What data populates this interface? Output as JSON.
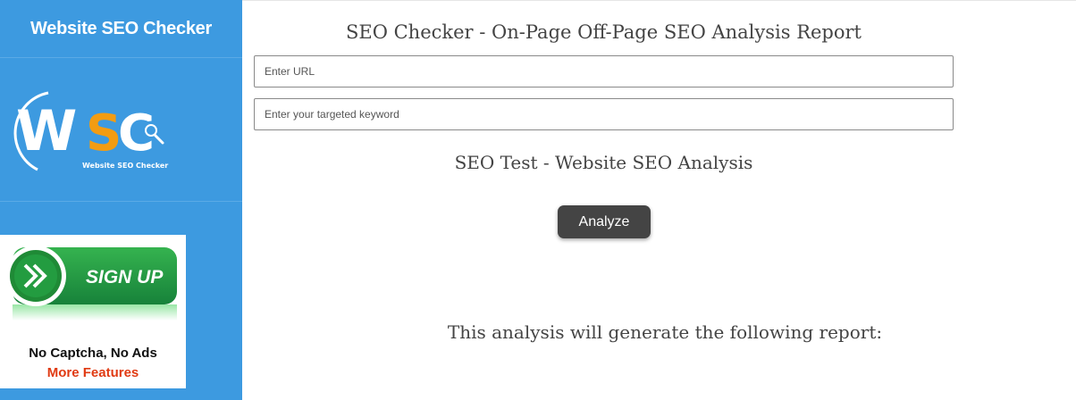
{
  "sidebar": {
    "title": "Website SEO Checker",
    "logo": {
      "letters": [
        "W",
        "S",
        "C"
      ],
      "tagline": "Website SEO Checker"
    },
    "promo": {
      "signup_label": "SIGN UP",
      "line1": "No Captcha, No Ads",
      "line2": "More Features"
    }
  },
  "main": {
    "title": "SEO Checker - On-Page Off-Page SEO Analysis Report",
    "url_placeholder": "Enter URL",
    "keyword_placeholder": "Enter your targeted keyword",
    "subtitle": "SEO Test - Website SEO Analysis",
    "analyze_label": "Analyze",
    "report_note": "This analysis will generate the following report:"
  },
  "colors": {
    "sidebar_bg": "#3d9ae0",
    "logo_accent": "#f39c12",
    "button_bg": "#444444",
    "signup_green": "#1f9a3a",
    "promo_highlight": "#e03a12"
  }
}
